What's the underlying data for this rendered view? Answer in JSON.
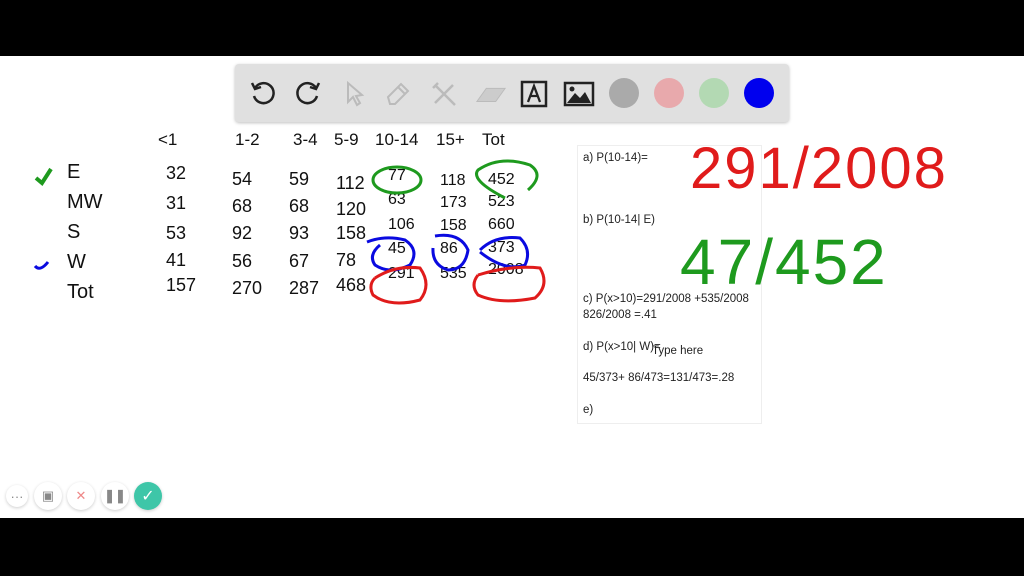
{
  "toolbar": {
    "tools": [
      "undo-icon",
      "redo-icon",
      "pointer-icon",
      "pen-icon",
      "tools-icon",
      "eraser-icon",
      "text-icon",
      "image-icon"
    ],
    "colors": [
      "#aaaaaa",
      "#e8a9ac",
      "#b3d9b3",
      "#0000ee"
    ],
    "selected_color": "#0000ee"
  },
  "table": {
    "headers": [
      "<1",
      "1-2",
      "3-4",
      "5-9",
      "10-14",
      "15+",
      "Tot"
    ],
    "rows": [
      {
        "label": "E",
        "values": [
          "32",
          "54",
          "59",
          "112",
          "77",
          "118",
          "452"
        ]
      },
      {
        "label": "MW",
        "values": [
          "31",
          "68",
          "68",
          "120",
          "63",
          "173",
          "523"
        ]
      },
      {
        "label": "S",
        "values": [
          "53",
          "92",
          "93",
          "158",
          "106",
          "158",
          "660"
        ]
      },
      {
        "label": "W",
        "values": [
          "41",
          "56",
          "67",
          "78",
          "45",
          "86",
          "373"
        ]
      },
      {
        "label": "Tot",
        "values": [
          "157",
          "270",
          "287",
          "468",
          "291",
          "535",
          "2008"
        ]
      }
    ]
  },
  "panel": {
    "lines": [
      "a) P(10-14)=",
      "b) P(10-14| E)",
      "c) P(x>10)=291/2008 +535/2008",
      "826/2008 =.41",
      "d) P(x>10| W)=",
      "45/373+ 86/473=131/473=.28",
      "e)"
    ],
    "placeholder": "Type here"
  },
  "handwriting": {
    "a": "291/2008",
    "b": "47/452",
    "colors": {
      "green": "#1e9a1e",
      "red": "#e01b1b",
      "blue": "#0a0ae0"
    }
  },
  "controls": [
    "more-icon",
    "camera-icon",
    "close-icon",
    "pause-icon",
    "check-icon"
  ]
}
